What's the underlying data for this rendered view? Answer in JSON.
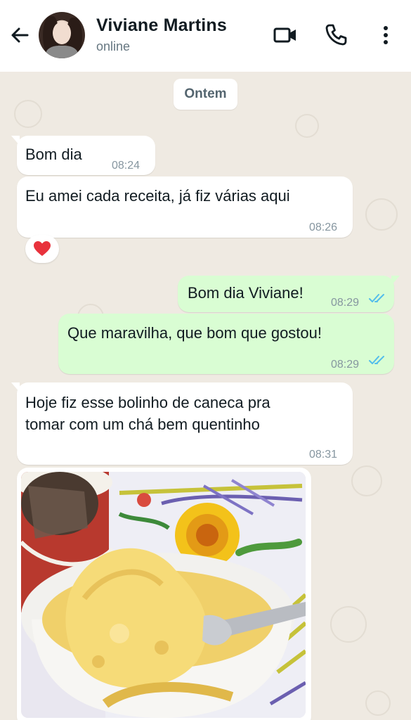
{
  "header": {
    "contact_name": "Viviane Martins",
    "status": "online"
  },
  "chat": {
    "date_divider": "Ontem",
    "messages": [
      {
        "direction": "in",
        "text": "Bom dia",
        "time": "08:24"
      },
      {
        "direction": "in",
        "text": "Eu amei cada receita, já fiz várias aqui",
        "time": "08:26",
        "reaction": "❤️"
      },
      {
        "direction": "out",
        "text": "Bom dia Viviane!",
        "time": "08:29",
        "read": true
      },
      {
        "direction": "out",
        "text": "Que maravilha, que bom que gostou!",
        "time": "08:29",
        "read": true
      },
      {
        "direction": "in",
        "text_lines": [
          "Hoje fiz esse bolinho de caneca pra",
          "tomar com um chá bem quentinho"
        ],
        "time": "08:31"
      },
      {
        "direction": "in",
        "type": "image"
      }
    ]
  },
  "icons": {
    "back": "arrow-left-icon",
    "video": "video-call-icon",
    "phone": "phone-icon",
    "menu": "more-vertical-icon",
    "read_receipt": "double-check-icon"
  },
  "colors": {
    "header_bg": "#ffffff",
    "chat_bg": "#efeae2",
    "incoming_bubble": "#ffffff",
    "outgoing_bubble": "#d9fdd3",
    "read_tick": "#53bdeb"
  }
}
